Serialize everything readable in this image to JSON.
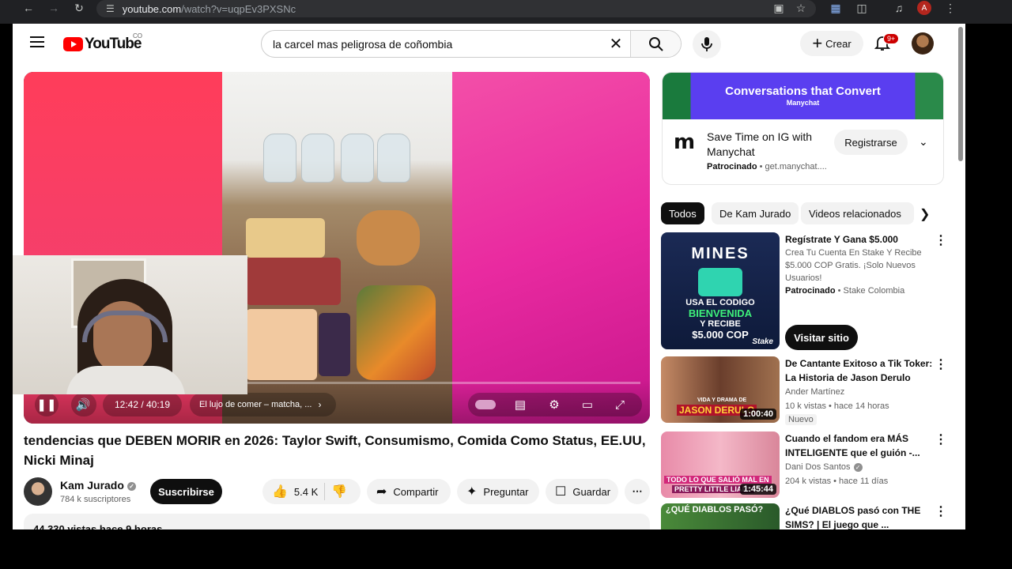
{
  "browser": {
    "url_host": "youtube.com",
    "url_path": "/watch?v=uqpEv3PXSNc",
    "profile_initial": "A"
  },
  "header": {
    "logo_text": "YouTube",
    "country_code": "CO",
    "search_query": "la carcel mas peligrosa de coñombia",
    "create_label": "Crear",
    "notif_count": "9+"
  },
  "player": {
    "time_current_total": "12:42 / 40:19",
    "chapter_title": "El lujo de comer – matcha, ...",
    "progress_fraction": 0.315
  },
  "video": {
    "title": "tendencias que DEBEN MORIR en 2026: Taylor Swift, Consumismo, Comida Como Status, EE.UU, Nicki Minaj",
    "channel_name": "Kam Jurado",
    "subscribers": "784 k suscriptores",
    "subscribe_label": "Suscribirse",
    "likes": "5.4 K",
    "share_label": "Compartir",
    "ask_label": "Preguntar",
    "save_label": "Guardar",
    "description_preview": "44.330 vistas  hace 9 horas"
  },
  "ad": {
    "banner_title": "Conversations that Convert",
    "banner_brand": "Manychat",
    "title": "Save Time on IG with Manychat",
    "sponsored": "Patrocinado",
    "domain": "get.manychat....",
    "cta": "Registrarse"
  },
  "chips": [
    "Todos",
    "De Kam Jurado",
    "Videos relacionados"
  ],
  "recs": [
    {
      "title": "Regístrate Y Gana $5.000",
      "desc": "Crea Tu Cuenta En Stake Y Recibe $5.000 COP Gratis. ¡Solo Nuevos Usuarios!",
      "sponsored": "Patrocinado",
      "advertiser": "Stake Colombia",
      "cta": "Visitar sitio",
      "thumb_top": "MINES",
      "thumb_mid": "USA EL CODIGO",
      "thumb_bienvenida": "BIENVENIDA",
      "thumb_recibe": "Y RECIBE",
      "thumb_amount": "$5.000 COP",
      "thumb_brand": "Stake"
    },
    {
      "title": "De Cantante Exitoso a Tik Toker: La Historia de Jason Derulo",
      "channel": "Ander Martínez",
      "stats": "10 k vistas  •  hace 14 horas",
      "badge": "Nuevo",
      "duration": "1:00:40",
      "thumb_caption_small": "VIDA Y DRAMA DE",
      "thumb_caption": "JASON DERULO"
    },
    {
      "title": "Cuando el fandom era MÁS INTELIGENTE que el guión -...",
      "channel": "Dani Dos Santos",
      "stats": "204 k vistas  •  hace 11 días",
      "duration": "1:45:44",
      "thumb_caption": "TODO LO QUE SALIÓ MAL EN",
      "thumb_caption2": "PRETTY LITTLE LIARS"
    },
    {
      "title": "¿Qué DIABLOS pasó con THE SIMS? | El juego que ...",
      "thumb_caption": "¿QUÉ DIABLOS PASÓ?"
    }
  ],
  "colors": {
    "brand_red": "#ff0000",
    "text_primary": "#0f0f0f",
    "text_secondary": "#606060",
    "chip_bg": "#f2f2f2"
  },
  "icons": [
    "back-icon",
    "forward-icon",
    "reload-icon",
    "site-info-icon",
    "install-icon",
    "star-icon",
    "extensions-icon",
    "menu-icon",
    "search-icon",
    "mic-icon",
    "bell-icon",
    "pause-icon",
    "volume-icon",
    "subtitles-icon",
    "settings-icon",
    "theater-icon",
    "fullscreen-icon",
    "like-icon",
    "dislike-icon",
    "share-icon",
    "sparkle-icon",
    "bookmark-icon",
    "more-icon",
    "chevron-right-icon",
    "chevron-down-icon"
  ]
}
